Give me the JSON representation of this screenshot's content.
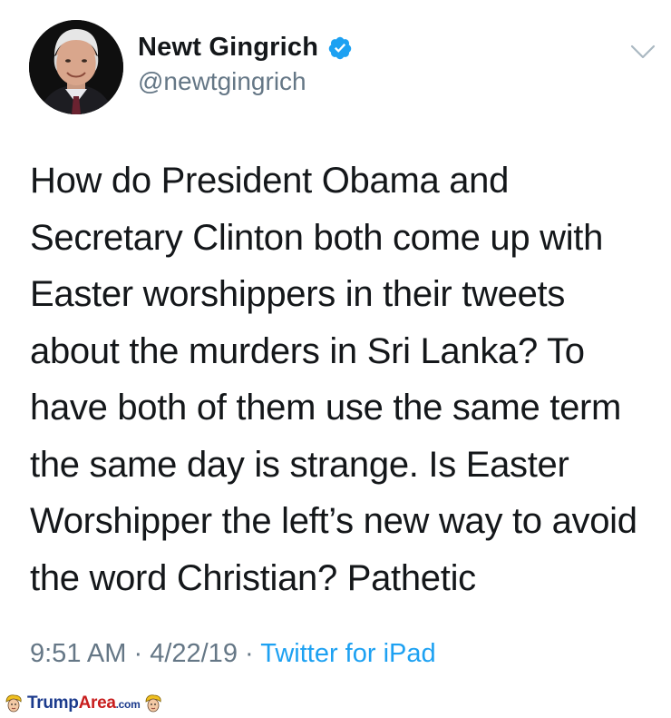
{
  "tweet": {
    "display_name": "Newt Gingrich",
    "handle": "@newtgingrich",
    "verified": true,
    "text_lines": [
      "How do President Obama and",
      "Secretary Clinton both come up with",
      "Easter worshippers in their tweets",
      "about the murders in Sri Lanka? To",
      "have both of them use the same term",
      "the same day is strange. Is Easter",
      "Worshipper the left’s new way to avoid",
      "the word Christian? Pathetic"
    ],
    "time": "9:51 AM",
    "separator": "·",
    "date": "4/22/19",
    "source": "Twitter for iPad"
  },
  "watermark": {
    "part1": "Trump",
    "part2": "Area",
    "part3": ".com"
  },
  "colors": {
    "verified": "#1da1f2",
    "link": "#1da1f2",
    "muted": "#657786",
    "text": "#14171a",
    "watermark_blue": "#1b3a8c",
    "watermark_red": "#c81e1e"
  },
  "icons": {
    "avatar": "profile-photo",
    "verified": "verified-badge-icon",
    "menu": "chevron-down-icon",
    "watermark": "trump-face-icon"
  }
}
